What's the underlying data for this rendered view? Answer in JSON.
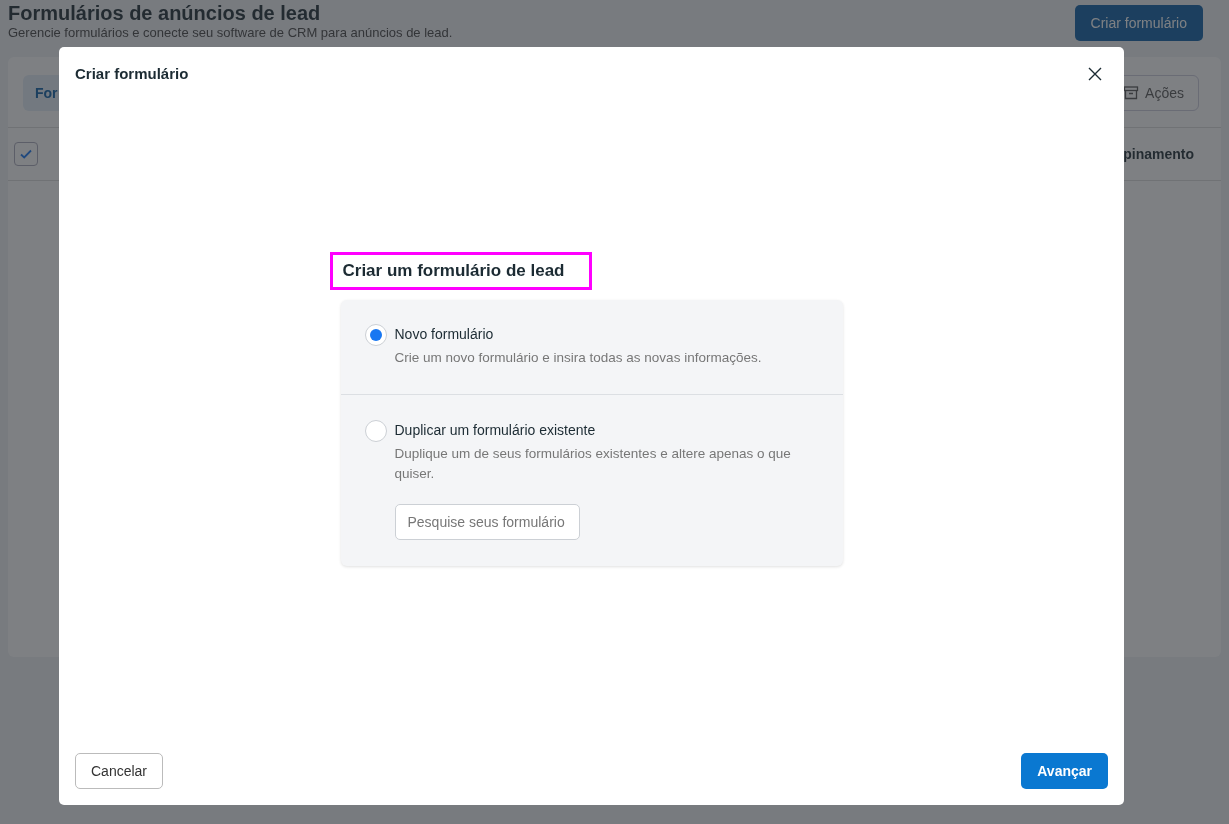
{
  "page": {
    "title": "Formulários de anúncios de lead",
    "subtitle": "Gerencie formulários e conecte seu software de CRM para anúncios de lead.",
    "create_button": "Criar formulário",
    "tab": "For",
    "actions_button": "Ações",
    "select_all_checked": true,
    "column_header": "pinamento"
  },
  "dialog": {
    "title": "Criar formulário",
    "heading": "Criar um formulário de lead",
    "highlighted": true,
    "options": [
      {
        "label": "Novo formulário",
        "description": "Crie um novo formulário e insira todas as novas informações.",
        "selected": true
      },
      {
        "label": "Duplicar um formulário existente",
        "description": "Duplique um de seus formulários existentes e altere apenas o que quiser.",
        "selected": false,
        "search": {
          "placeholder": "Pesquise seus formulário"
        }
      }
    ],
    "cancel_button": "Cancelar",
    "next_button": "Avançar"
  }
}
